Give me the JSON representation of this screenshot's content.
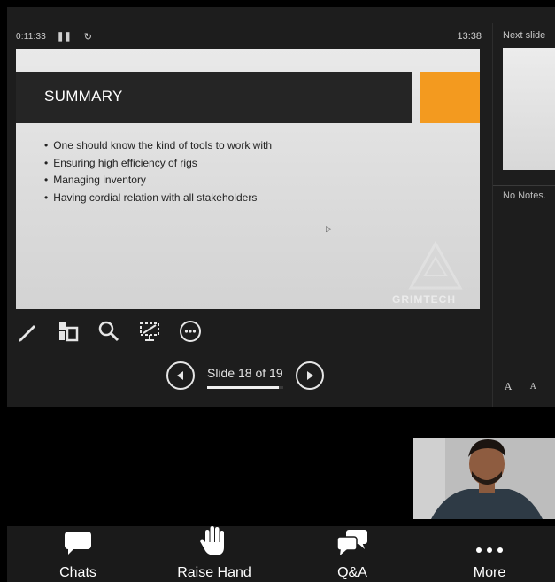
{
  "presenter": {
    "elapsed": "0:11:33",
    "clock": "13:38",
    "pause_icon": "pause-icon",
    "restart_icon": "restart-icon"
  },
  "slide": {
    "title": "SUMMARY",
    "bullets": [
      "One should know the kind of tools to work with",
      "Ensuring high efficiency of rigs",
      "Managing inventory",
      "Having cordial relation with all stakeholders"
    ],
    "watermark": "GRIMTECH",
    "accent": "#f39a1f"
  },
  "tools": [
    "pen-icon",
    "slides-grid-icon",
    "zoom-icon",
    "screen-icon",
    "more-options-icon"
  ],
  "navigation": {
    "counter": "Slide 18 of 19",
    "progress": 0.947
  },
  "side_panel": {
    "next_label": "Next slide",
    "notes": "No Notes.",
    "font_increase": "A",
    "font_decrease": "A"
  },
  "bottom_bar": {
    "chats": "Chats",
    "raise_hand": "Raise Hand",
    "qa": "Q&A",
    "more": "More"
  }
}
